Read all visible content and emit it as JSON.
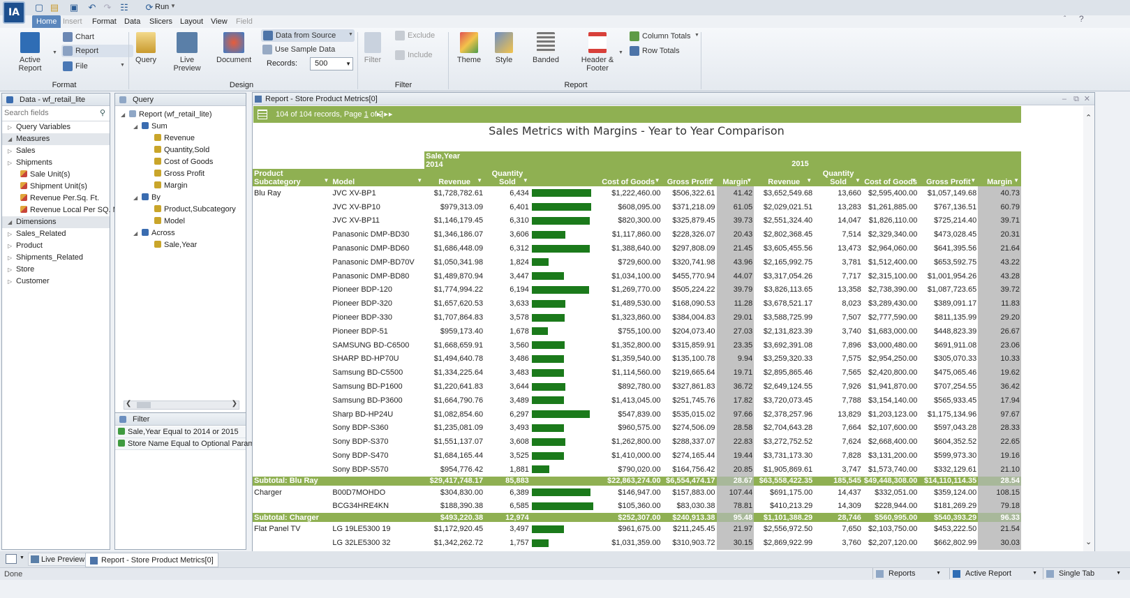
{
  "app": {
    "logo": "IA",
    "run_label": "Run"
  },
  "menu": [
    "Home",
    "Insert",
    "Format",
    "Data",
    "Slicers",
    "Layout",
    "View",
    "Field"
  ],
  "ribbon": {
    "format": {
      "group": "Format",
      "active_report": "Active Report",
      "chart": "Chart",
      "report": "Report",
      "file": "File"
    },
    "design": {
      "group": "Design",
      "query": "Query",
      "live_preview": "Live\nPreview",
      "document": "Document",
      "data_from_source": "Data from Source",
      "use_sample_data": "Use Sample Data",
      "records_label": "Records:",
      "records_value": "500"
    },
    "filter": {
      "group": "Filter",
      "filter": "Filter",
      "exclude": "Exclude",
      "include": "Include"
    },
    "report": {
      "group": "Report",
      "theme": "Theme",
      "style": "Style",
      "banded": "Banded",
      "header_footer": "Header &\nFooter",
      "column_totals": "Column Totals",
      "row_totals": "Row Totals"
    }
  },
  "data_panel": {
    "title": "Data - wf_retail_lite",
    "search_placeholder": "Search fields",
    "items": [
      {
        "label": "Query Variables",
        "kind": "node"
      },
      {
        "label": "Measures",
        "kind": "sect"
      },
      {
        "label": "Sales",
        "kind": "node"
      },
      {
        "label": "Shipments",
        "kind": "node"
      },
      {
        "label": "Sale Unit(s)",
        "kind": "field"
      },
      {
        "label": "Shipment Unit(s)",
        "kind": "field"
      },
      {
        "label": "Revenue Per.Sq. Ft.",
        "kind": "field"
      },
      {
        "label": "Revenue Local Per SQ. M.",
        "kind": "field"
      },
      {
        "label": "Dimensions",
        "kind": "sect"
      },
      {
        "label": "Sales_Related",
        "kind": "node"
      },
      {
        "label": "Product",
        "kind": "node"
      },
      {
        "label": "Shipments_Related",
        "kind": "node"
      },
      {
        "label": "Store",
        "kind": "node"
      },
      {
        "label": "Customer",
        "kind": "node"
      }
    ]
  },
  "query_panel": {
    "title": "Query",
    "items": [
      {
        "label": "Report (wf_retail_lite)",
        "lvl": 0
      },
      {
        "label": "Sum",
        "lvl": 1
      },
      {
        "label": "Revenue",
        "lvl": 2
      },
      {
        "label": "Quantity,Sold",
        "lvl": 2
      },
      {
        "label": "Cost of Goods",
        "lvl": 2
      },
      {
        "label": "Gross Profit",
        "lvl": 2
      },
      {
        "label": "Margin",
        "lvl": 2
      },
      {
        "label": "By",
        "lvl": 1
      },
      {
        "label": "Product,Subcategory",
        "lvl": 2
      },
      {
        "label": "Model",
        "lvl": 2
      },
      {
        "label": "Across",
        "lvl": 1
      },
      {
        "label": "Sale,Year",
        "lvl": 2
      }
    ]
  },
  "filter_panel": {
    "title": "Filter",
    "items": [
      "Sale,Year Equal to 2014 or 2015",
      "Store Name Equal to Optional Paramet"
    ]
  },
  "report": {
    "window_title": "Report - Store Product Metrics[0]",
    "records_text": "104 of 104 records, Page ",
    "page_num": "1",
    "page_of": " of 2",
    "title": "Sales Metrics with Margins - Year to Year Comparison",
    "across_label": "Sale,Year",
    "year1": "2014",
    "year2": "2015",
    "col_product": "Product\nSubcategory",
    "col_model": "Model",
    "col_revenue": "Revenue",
    "col_qty": "Quantity\nSold",
    "col_cog": "Cost of Goods",
    "col_gp": "Gross Profit",
    "col_margin": "Margin",
    "rows": [
      {
        "cat": "Blu Ray",
        "model": "JVC XV-BP1",
        "r1": "$1,728,782.61",
        "q1": "6,434",
        "bar": 0.97,
        "c1": "$1,222,460.00",
        "g1": "$506,322.61",
        "m1": "41.42",
        "r2": "$3,652,549.68",
        "q2": "13,660",
        "c2": "$2,595,400.00",
        "g2": "$1,057,149.68",
        "m2": "40.73"
      },
      {
        "cat": "",
        "model": "JVC XV-BP10",
        "r1": "$979,313.09",
        "q1": "6,401",
        "bar": 0.97,
        "c1": "$608,095.00",
        "g1": "$371,218.09",
        "m1": "61.05",
        "r2": "$2,029,021.51",
        "q2": "13,283",
        "c2": "$1,261,885.00",
        "g2": "$767,136.51",
        "m2": "60.79"
      },
      {
        "cat": "",
        "model": "JVC XV-BP11",
        "r1": "$1,146,179.45",
        "q1": "6,310",
        "bar": 0.95,
        "c1": "$820,300.00",
        "g1": "$325,879.45",
        "m1": "39.73",
        "r2": "$2,551,324.40",
        "q2": "14,047",
        "c2": "$1,826,110.00",
        "g2": "$725,214.40",
        "m2": "39.71"
      },
      {
        "cat": "",
        "model": "Panasonic DMP-BD30",
        "r1": "$1,346,186.07",
        "q1": "3,606",
        "bar": 0.55,
        "c1": "$1,117,860.00",
        "g1": "$228,326.07",
        "m1": "20.43",
        "r2": "$2,802,368.45",
        "q2": "7,514",
        "c2": "$2,329,340.00",
        "g2": "$473,028.45",
        "m2": "20.31"
      },
      {
        "cat": "",
        "model": "Panasonic DMP-BD60",
        "r1": "$1,686,448.09",
        "q1": "6,312",
        "bar": 0.95,
        "c1": "$1,388,640.00",
        "g1": "$297,808.09",
        "m1": "21.45",
        "r2": "$3,605,455.56",
        "q2": "13,473",
        "c2": "$2,964,060.00",
        "g2": "$641,395.56",
        "m2": "21.64"
      },
      {
        "cat": "",
        "model": "Panasonic DMP-BD70V",
        "r1": "$1,050,341.98",
        "q1": "1,824",
        "bar": 0.28,
        "c1": "$729,600.00",
        "g1": "$320,741.98",
        "m1": "43.96",
        "r2": "$2,165,992.75",
        "q2": "3,781",
        "c2": "$1,512,400.00",
        "g2": "$653,592.75",
        "m2": "43.22"
      },
      {
        "cat": "",
        "model": "Panasonic DMP-BD80",
        "r1": "$1,489,870.94",
        "q1": "3,447",
        "bar": 0.52,
        "c1": "$1,034,100.00",
        "g1": "$455,770.94",
        "m1": "44.07",
        "r2": "$3,317,054.26",
        "q2": "7,717",
        "c2": "$2,315,100.00",
        "g2": "$1,001,954.26",
        "m2": "43.28"
      },
      {
        "cat": "",
        "model": "Pioneer BDP-120",
        "r1": "$1,774,994.22",
        "q1": "6,194",
        "bar": 0.93,
        "c1": "$1,269,770.00",
        "g1": "$505,224.22",
        "m1": "39.79",
        "r2": "$3,826,113.65",
        "q2": "13,358",
        "c2": "$2,738,390.00",
        "g2": "$1,087,723.65",
        "m2": "39.72"
      },
      {
        "cat": "",
        "model": "Pioneer BDP-320",
        "r1": "$1,657,620.53",
        "q1": "3,633",
        "bar": 0.55,
        "c1": "$1,489,530.00",
        "g1": "$168,090.53",
        "m1": "11.28",
        "r2": "$3,678,521.17",
        "q2": "8,023",
        "c2": "$3,289,430.00",
        "g2": "$389,091.17",
        "m2": "11.83"
      },
      {
        "cat": "",
        "model": "Pioneer BDP-330",
        "r1": "$1,707,864.83",
        "q1": "3,578",
        "bar": 0.54,
        "c1": "$1,323,860.00",
        "g1": "$384,004.83",
        "m1": "29.01",
        "r2": "$3,588,725.99",
        "q2": "7,507",
        "c2": "$2,777,590.00",
        "g2": "$811,135.99",
        "m2": "29.20"
      },
      {
        "cat": "",
        "model": "Pioneer BDP-51",
        "r1": "$959,173.40",
        "q1": "1,678",
        "bar": 0.26,
        "c1": "$755,100.00",
        "g1": "$204,073.40",
        "m1": "27.03",
        "r2": "$2,131,823.39",
        "q2": "3,740",
        "c2": "$1,683,000.00",
        "g2": "$448,823.39",
        "m2": "26.67"
      },
      {
        "cat": "",
        "model": "SAMSUNG BD-C6500",
        "r1": "$1,668,659.91",
        "q1": "3,560",
        "bar": 0.54,
        "c1": "$1,352,800.00",
        "g1": "$315,859.91",
        "m1": "23.35",
        "r2": "$3,692,391.08",
        "q2": "7,896",
        "c2": "$3,000,480.00",
        "g2": "$691,911.08",
        "m2": "23.06"
      },
      {
        "cat": "",
        "model": "SHARP BD-HP70U",
        "r1": "$1,494,640.78",
        "q1": "3,486",
        "bar": 0.53,
        "c1": "$1,359,540.00",
        "g1": "$135,100.78",
        "m1": "9.94",
        "r2": "$3,259,320.33",
        "q2": "7,575",
        "c2": "$2,954,250.00",
        "g2": "$305,070.33",
        "m2": "10.33"
      },
      {
        "cat": "",
        "model": "Samsung BD-C5500",
        "r1": "$1,334,225.64",
        "q1": "3,483",
        "bar": 0.53,
        "c1": "$1,114,560.00",
        "g1": "$219,665.64",
        "m1": "19.71",
        "r2": "$2,895,865.46",
        "q2": "7,565",
        "c2": "$2,420,800.00",
        "g2": "$475,065.46",
        "m2": "19.62"
      },
      {
        "cat": "",
        "model": "Samsung BD-P1600",
        "r1": "$1,220,641.83",
        "q1": "3,644",
        "bar": 0.55,
        "c1": "$892,780.00",
        "g1": "$327,861.83",
        "m1": "36.72",
        "r2": "$2,649,124.55",
        "q2": "7,926",
        "c2": "$1,941,870.00",
        "g2": "$707,254.55",
        "m2": "36.42"
      },
      {
        "cat": "",
        "model": "Samsung BD-P3600",
        "r1": "$1,664,790.76",
        "q1": "3,489",
        "bar": 0.53,
        "c1": "$1,413,045.00",
        "g1": "$251,745.76",
        "m1": "17.82",
        "r2": "$3,720,073.45",
        "q2": "7,788",
        "c2": "$3,154,140.00",
        "g2": "$565,933.45",
        "m2": "17.94"
      },
      {
        "cat": "",
        "model": "Sharp BD-HP24U",
        "r1": "$1,082,854.60",
        "q1": "6,297",
        "bar": 0.95,
        "c1": "$547,839.00",
        "g1": "$535,015.02",
        "m1": "97.66",
        "r2": "$2,378,257.96",
        "q2": "13,829",
        "c2": "$1,203,123.00",
        "g2": "$1,175,134.96",
        "m2": "97.67"
      },
      {
        "cat": "",
        "model": "Sony BDP-S360",
        "r1": "$1,235,081.09",
        "q1": "3,493",
        "bar": 0.53,
        "c1": "$960,575.00",
        "g1": "$274,506.09",
        "m1": "28.58",
        "r2": "$2,704,643.28",
        "q2": "7,664",
        "c2": "$2,107,600.00",
        "g2": "$597,043.28",
        "m2": "28.33"
      },
      {
        "cat": "",
        "model": "Sony BDP-S370",
        "r1": "$1,551,137.07",
        "q1": "3,608",
        "bar": 0.55,
        "c1": "$1,262,800.00",
        "g1": "$288,337.07",
        "m1": "22.83",
        "r2": "$3,272,752.52",
        "q2": "7,624",
        "c2": "$2,668,400.00",
        "g2": "$604,352.52",
        "m2": "22.65"
      },
      {
        "cat": "",
        "model": "Sony BDP-S470",
        "r1": "$1,684,165.44",
        "q1": "3,525",
        "bar": 0.53,
        "c1": "$1,410,000.00",
        "g1": "$274,165.44",
        "m1": "19.44",
        "r2": "$3,731,173.30",
        "q2": "7,828",
        "c2": "$3,131,200.00",
        "g2": "$599,973.30",
        "m2": "19.16"
      },
      {
        "cat": "",
        "model": "Sony BDP-S570",
        "r1": "$954,776.42",
        "q1": "1,881",
        "bar": 0.29,
        "c1": "$790,020.00",
        "g1": "$164,756.42",
        "m1": "20.85",
        "r2": "$1,905,869.61",
        "q2": "3,747",
        "c2": "$1,573,740.00",
        "g2": "$332,129.61",
        "m2": "21.10"
      },
      {
        "sub": true,
        "cat": "Subtotal: Blu Ray",
        "r1": "$29,417,748.17",
        "q1": "85,883",
        "c1": "$22,863,274.00",
        "g1": "$6,554,474.17",
        "m1": "28.67",
        "r2": "$63,558,422.35",
        "q2": "185,545",
        "c2": "$49,448,308.00",
        "g2": "$14,110,114.35",
        "m2": "28.54"
      },
      {
        "cat": "Charger",
        "model": "B00D7MOHDO",
        "r1": "$304,830.00",
        "q1": "6,389",
        "bar": 0.96,
        "c1": "$146,947.00",
        "g1": "$157,883.00",
        "m1": "107.44",
        "r2": "$691,175.00",
        "q2": "14,437",
        "c2": "$332,051.00",
        "g2": "$359,124.00",
        "m2": "108.15"
      },
      {
        "cat": "",
        "model": "BCG34HRE4KN",
        "r1": "$188,390.38",
        "q1": "6,585",
        "bar": 1.0,
        "c1": "$105,360.00",
        "g1": "$83,030.38",
        "m1": "78.81",
        "r2": "$410,213.29",
        "q2": "14,309",
        "c2": "$228,944.00",
        "g2": "$181,269.29",
        "m2": "79.18"
      },
      {
        "sub": true,
        "cat": "Subtotal: Charger",
        "r1": "$493,220.38",
        "q1": "12,974",
        "c1": "$252,307.00",
        "g1": "$240,913.38",
        "m1": "95.48",
        "r2": "$1,101,388.29",
        "q2": "28,746",
        "c2": "$560,995.00",
        "g2": "$540,393.29",
        "m2": "96.33"
      },
      {
        "cat": "Flat Panel TV",
        "model": "LG 19LE5300 19",
        "r1": "$1,172,920.45",
        "q1": "3,497",
        "bar": 0.53,
        "c1": "$961,675.00",
        "g1": "$211,245.45",
        "m1": "21.97",
        "r2": "$2,556,972.50",
        "q2": "7,650",
        "c2": "$2,103,750.00",
        "g2": "$453,222.50",
        "m2": "21.54"
      },
      {
        "cat": "",
        "model": "LG 32LE5300 32",
        "r1": "$1,342,262.72",
        "q1": "1,757",
        "bar": 0.27,
        "c1": "$1,031,359.00",
        "g1": "$310,903.72",
        "m1": "30.15",
        "r2": "$2,869,922.99",
        "q2": "3,760",
        "c2": "$2,207,120.00",
        "g2": "$662,802.99",
        "m2": "30.03"
      }
    ]
  },
  "taskbar": {
    "live_preview": "Live Preview",
    "report_tab": "Report - Store Product Metrics[0]"
  },
  "status": {
    "text": "Done",
    "reports": "Reports",
    "active_report": "Active Report",
    "single_tab": "Single Tab"
  },
  "colors": {
    "accent": "#8fb052",
    "bar": "#1b7a1b",
    "margin_col": "#c3c3c3",
    "tab_active": "#5b87bd"
  }
}
